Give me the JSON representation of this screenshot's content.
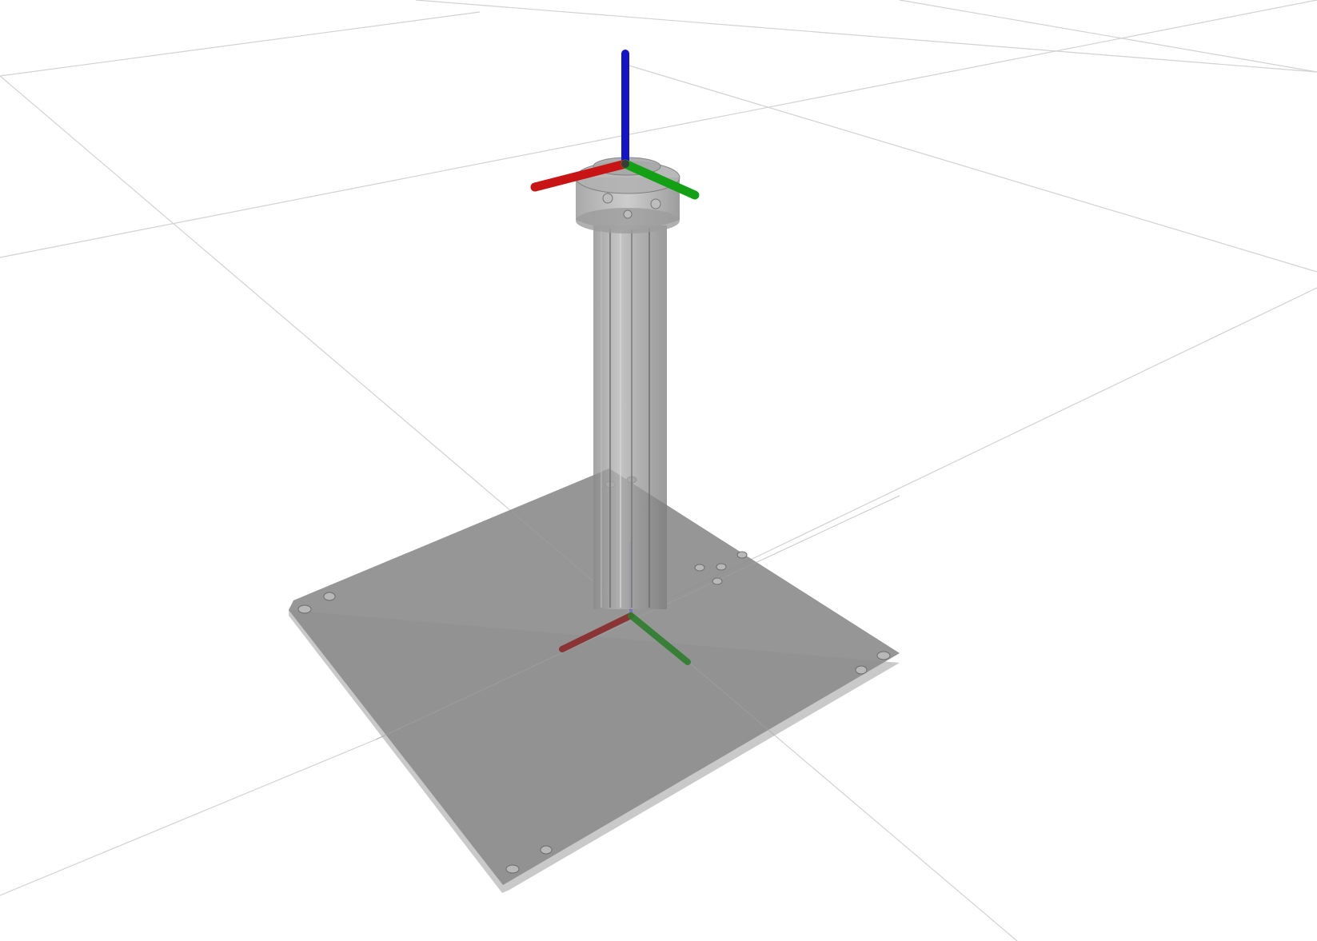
{
  "scene": {
    "background_color": "#ffffff",
    "grid_color": "#d2d2d2",
    "plate_color": "#8e8e8e",
    "column_color": "#9a9a9a",
    "axes": {
      "x_color": "#c81414",
      "y_color": "#14a014",
      "z_color": "#1414c8"
    },
    "frames": [
      "base-frame",
      "tool-frame"
    ],
    "icons": {
      "x_axis": "x-axis-icon",
      "y_axis": "y-axis-icon",
      "z_axis": "z-axis-icon"
    }
  }
}
